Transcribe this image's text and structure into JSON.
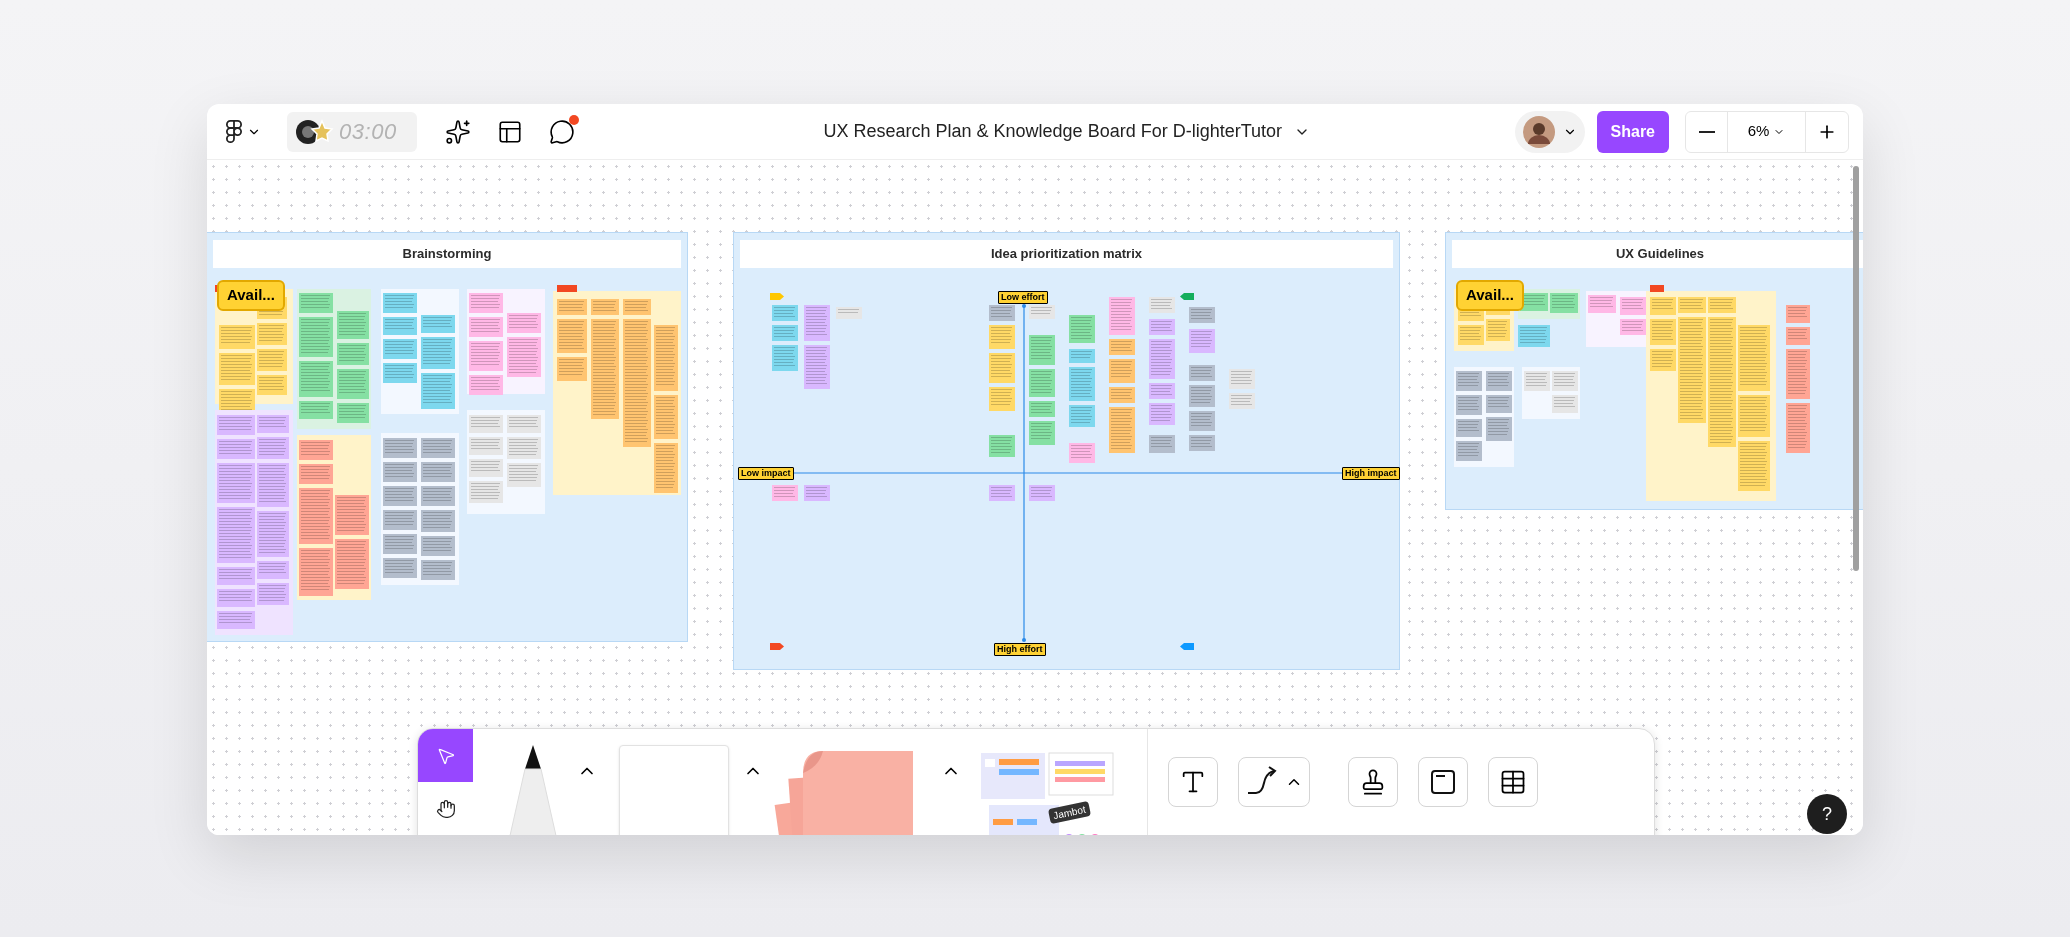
{
  "topbar": {
    "timer": "03:00",
    "comment_unread": true,
    "title": "UX Research Plan & Knowledge Board For D-lighterTutor",
    "share": "Share",
    "zoom": "6%"
  },
  "boards": [
    {
      "kind": "brainstorm",
      "title": "Brainstorming",
      "badge": "Avail..."
    },
    {
      "kind": "matrix",
      "title": "Idea prioritization matrix",
      "axis_labels": {
        "top": "Low effort",
        "bottom": "High effort",
        "left": "Low impact",
        "right": "High impact"
      }
    },
    {
      "kind": "guidelines",
      "title": "UX Guidelines",
      "badge": "Avail..."
    }
  ],
  "toolbar": {
    "tools": [
      {
        "kind": "pointer",
        "selected": true
      },
      {
        "kind": "hand",
        "selected": false
      }
    ],
    "template_tag": "Jambot"
  },
  "help": "?"
}
